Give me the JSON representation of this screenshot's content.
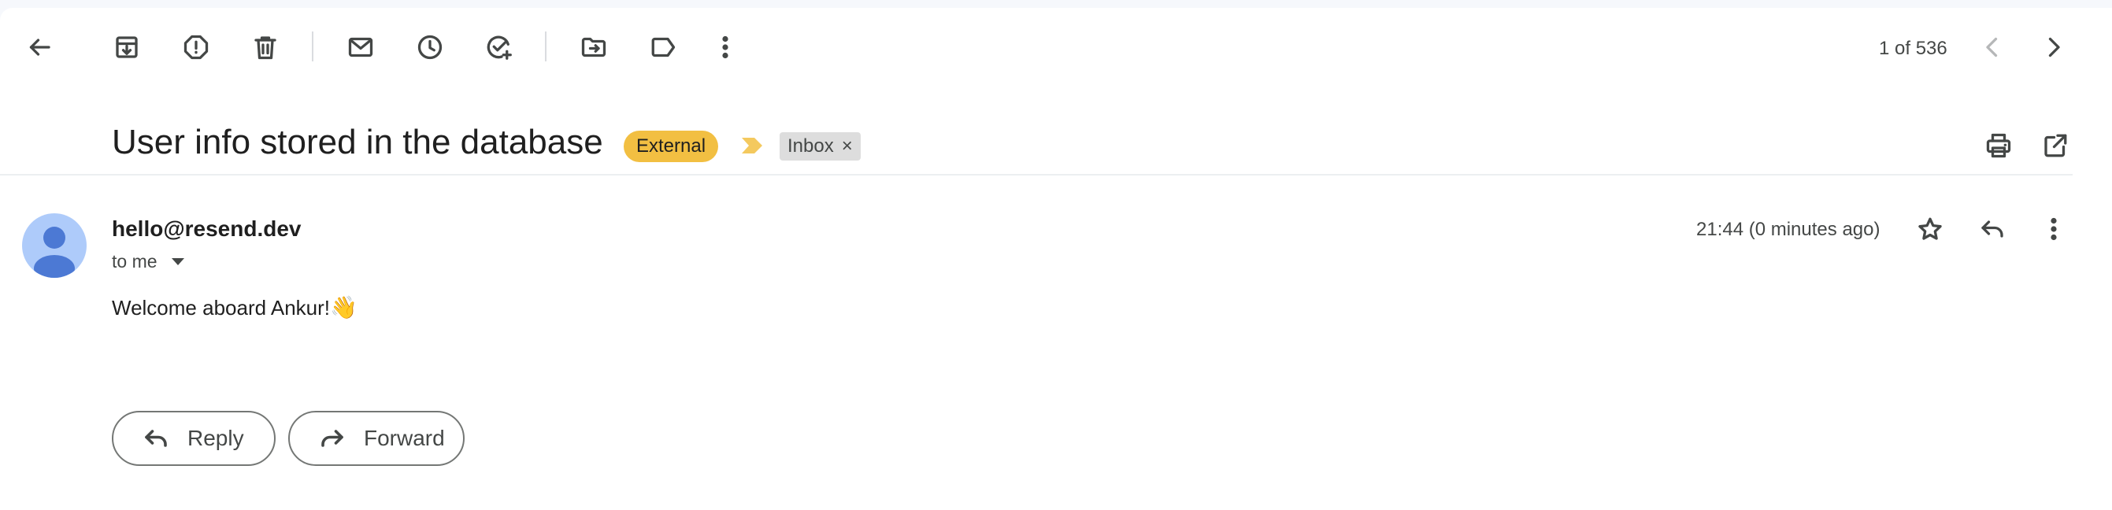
{
  "toolbar": {
    "icons": [
      "back-arrow-icon",
      "archive-icon",
      "report-spam-icon",
      "delete-icon",
      "mark-unread-icon",
      "snooze-icon",
      "add-to-tasks-icon",
      "move-to-icon",
      "labels-icon",
      "more-vert-icon"
    ],
    "pager_text": "1 of 536",
    "pager_icons": [
      "chevron-left-icon",
      "chevron-right-icon"
    ]
  },
  "subject": {
    "title": "User info stored in the database",
    "external_badge": "External",
    "external_badge_color": "#f2bf42",
    "importance_marker_color": "#f2bf42",
    "label": "Inbox",
    "label_remove": "×",
    "actions": [
      "print-icon",
      "open-in-new-window-icon"
    ]
  },
  "message": {
    "sender": "hello@resend.dev",
    "recipient_line": "to me",
    "timestamp": "21:44 (0 minutes ago)",
    "actions": [
      "star-icon",
      "reply-icon",
      "more-vert-icon"
    ],
    "body": "Welcome aboard Ankur!",
    "body_emoji": "👋"
  },
  "footer_actions": {
    "reply_label": "Reply",
    "forward_label": "Forward"
  },
  "colors": {
    "avatar_bg": "#aecbfa",
    "avatar_fg": "#4c79d4",
    "background": "#ffffff"
  }
}
